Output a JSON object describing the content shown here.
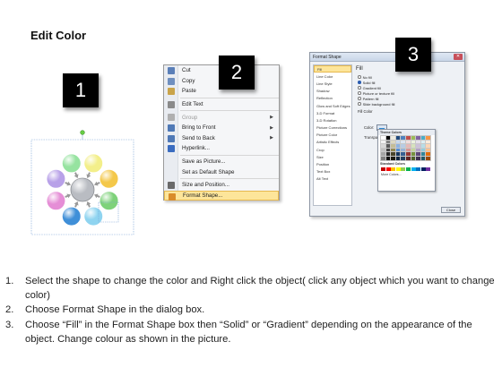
{
  "page_title": "Edit Color",
  "steps": {
    "one": "1",
    "two": "2",
    "three": "3"
  },
  "context_menu": {
    "items": [
      {
        "label": "Cut",
        "icon": "scissors-icon",
        "enabled": true,
        "submenu": false,
        "highlighted": false,
        "icon_color": "#5a7fb8"
      },
      {
        "label": "Copy",
        "icon": "copy-icon",
        "enabled": true,
        "submenu": false,
        "highlighted": false,
        "icon_color": "#6f8fbf"
      },
      {
        "label": "Paste",
        "icon": "paste-icon",
        "enabled": true,
        "submenu": false,
        "highlighted": false,
        "icon_color": "#c9a44a"
      },
      {
        "label": "Edit Text",
        "icon": "edit-text-icon",
        "enabled": true,
        "submenu": false,
        "highlighted": false,
        "icon_color": "#8a8a8a"
      },
      {
        "label": "Group",
        "icon": "group-icon",
        "enabled": false,
        "submenu": true,
        "highlighted": false,
        "icon_color": "#b0b0b0"
      },
      {
        "label": "Bring to Front",
        "icon": "bring-to-front-icon",
        "enabled": true,
        "submenu": true,
        "highlighted": false,
        "icon_color": "#4f79b6"
      },
      {
        "label": "Send to Back",
        "icon": "send-to-back-icon",
        "enabled": true,
        "submenu": true,
        "highlighted": false,
        "icon_color": "#4f79b6"
      },
      {
        "label": "Hyperlink...",
        "icon": "hyperlink-icon",
        "enabled": true,
        "submenu": false,
        "highlighted": false,
        "icon_color": "#3a6cc0"
      },
      {
        "label": "Save as Picture...",
        "icon": "",
        "enabled": true,
        "submenu": false,
        "highlighted": false,
        "icon_color": ""
      },
      {
        "label": "Set as Default Shape",
        "icon": "",
        "enabled": true,
        "submenu": false,
        "highlighted": false,
        "icon_color": ""
      },
      {
        "label": "Size and Position...",
        "icon": "size-position-icon",
        "enabled": true,
        "submenu": false,
        "highlighted": false,
        "icon_color": "#6a6a6a"
      },
      {
        "label": "Format Shape...",
        "icon": "format-shape-icon",
        "enabled": true,
        "submenu": false,
        "highlighted": true,
        "icon_color": "#d98c2a"
      }
    ]
  },
  "format_dialog": {
    "title": "Format Shape",
    "nav_items": [
      "Fill",
      "Line Color",
      "Line Style",
      "Shadow",
      "Reflection",
      "Glow and Soft Edges",
      "3-D Format",
      "3-D Rotation",
      "Picture Corrections",
      "Picture Color",
      "Artistic Effects",
      "Crop",
      "Size",
      "Position",
      "Text Box",
      "Alt Text"
    ],
    "active_nav": "Fill",
    "heading": "Fill",
    "fill_options": [
      "No fill",
      "Solid fill",
      "Gradient fill",
      "Picture or texture fill",
      "Pattern fill",
      "Slide background fill"
    ],
    "selected_fill": "Solid fill",
    "sub_heading": "Fill Color",
    "color_label": "Color:",
    "transparency_label": "Transparency:",
    "close_label": "Close"
  },
  "color_palette": {
    "theme_label": "Theme Colors",
    "standard_label": "Standard Colors",
    "more_label": "More Colors...",
    "theme_colors": [
      "#ffffff",
      "#000000",
      "#eeece1",
      "#1f497d",
      "#4f81bd",
      "#c0504d",
      "#9bbb59",
      "#8064a2",
      "#4bacc6",
      "#f79646",
      "#f2f2f2",
      "#7f7f7f",
      "#ddd9c3",
      "#c6d9f0",
      "#dbe5f1",
      "#f2dcdb",
      "#ebf1dd",
      "#e5e0ec",
      "#dbeef3",
      "#fdeada",
      "#d8d8d8",
      "#595959",
      "#c4bd97",
      "#8db3e2",
      "#b8cce4",
      "#e5b9b7",
      "#d7e3bc",
      "#ccc1d9",
      "#b7dde8",
      "#fbd5b5",
      "#bfbfbf",
      "#3f3f3f",
      "#938953",
      "#548dd4",
      "#95b3d7",
      "#d99694",
      "#c3d69b",
      "#b2a2c7",
      "#92cddc",
      "#fac08f",
      "#a5a5a5",
      "#262626",
      "#494429",
      "#17365d",
      "#366092",
      "#953734",
      "#76923c",
      "#5f497a",
      "#31859b",
      "#e36c09",
      "#7f7f7f",
      "#0c0c0c",
      "#1d1b10",
      "#0f243e",
      "#244061",
      "#632423",
      "#4f6128",
      "#3f3151",
      "#205867",
      "#974806"
    ],
    "standard_colors": [
      "#c00000",
      "#ff0000",
      "#ffc000",
      "#ffff00",
      "#92d050",
      "#00b050",
      "#00b0f0",
      "#0070c0",
      "#002060",
      "#7030a0"
    ]
  },
  "diagram": {
    "center_color": "#b9bcc2",
    "outer_colors": [
      "#f3ef8a",
      "#f4c84a",
      "#7ed27a",
      "#8fd4f0",
      "#3f8fd8",
      "#e58ed6",
      "#b8a1e8",
      "#96e3a0"
    ]
  },
  "instructions": [
    {
      "num": "1.",
      "text": "Select the shape to change the color and Right click the object( click any object which you want to change color)"
    },
    {
      "num": "2.",
      "text": "Choose Format Shape in the dialog box."
    },
    {
      "num": "3.",
      "text": "Choose “Fill” in the Format Shape box then “Solid” or “Gradient” depending on the appearance of the object. Change colour as shown in the picture."
    }
  ]
}
